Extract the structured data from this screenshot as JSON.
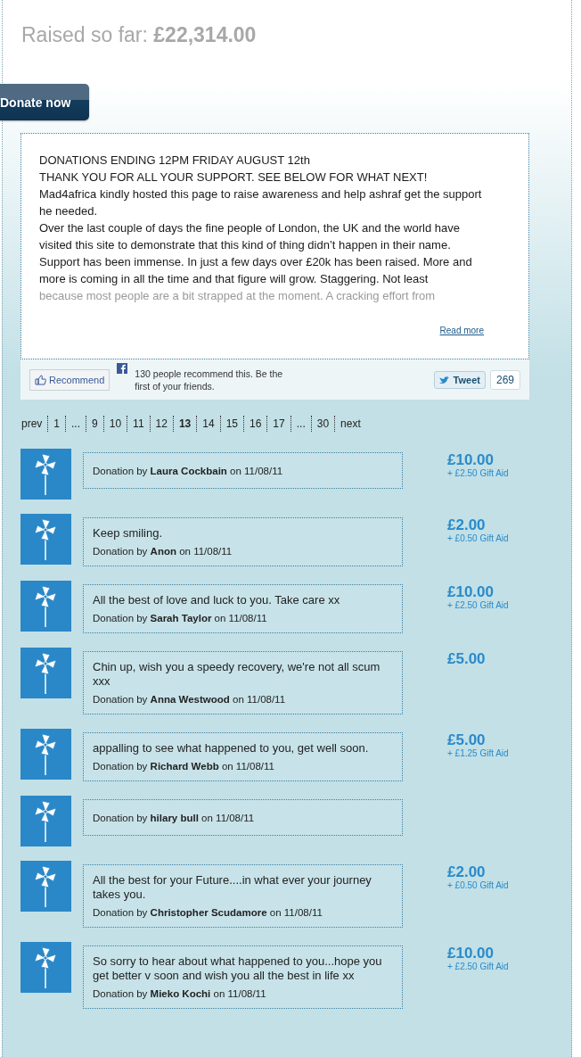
{
  "raised": {
    "label": "Raised so far:",
    "amount": "£22,314.00"
  },
  "donate_button": "Donate now",
  "story": {
    "lines": [
      "DONATIONS ENDING 12PM FRIDAY AUGUST 12th",
      "THANK YOU FOR ALL YOUR SUPPORT. SEE BELOW FOR WHAT NEXT!",
      "Mad4africa kindly hosted this page to raise awareness and  help ashraf get the support he needed.",
      "Over the last couple of days the fine people of London, the UK and the world have visited this site to demonstrate that this kind of thing didn’t happen in their name. Support has been immense. In just a few days over £20k has been raised. More and more is coming in all the time and that figure will grow. Staggering. Not least"
    ],
    "faded_line": "because most people are a bit strapped at the moment. A cracking effort from",
    "read_more": "Read more"
  },
  "social": {
    "recommend": "Recommend",
    "recommend_text": "130 people recommend this. Be the first of your friends.",
    "tweet": "Tweet",
    "tweet_count": "269"
  },
  "pagination": [
    {
      "label": "prev",
      "selected": false
    },
    {
      "label": "1",
      "selected": false
    },
    {
      "label": "...",
      "selected": false
    },
    {
      "label": "9",
      "selected": false
    },
    {
      "label": "10",
      "selected": false
    },
    {
      "label": "11",
      "selected": false
    },
    {
      "label": "12",
      "selected": false
    },
    {
      "label": "13",
      "selected": true
    },
    {
      "label": "14",
      "selected": false
    },
    {
      "label": "15",
      "selected": false
    },
    {
      "label": "16",
      "selected": false
    },
    {
      "label": "17",
      "selected": false
    },
    {
      "label": "...",
      "selected": false
    },
    {
      "label": "30",
      "selected": false
    },
    {
      "label": "next",
      "selected": false
    }
  ],
  "donations": [
    {
      "byline": "Donation by **Laura Cockbain** on 11/08/11",
      "amount": "£10.00",
      "gift_aid": "+ £2.50 Gift Aid"
    },
    {
      "message": "Keep smiling.",
      "byline": "Donation by **Anon** on 11/08/11",
      "amount": "£2.00",
      "gift_aid": "+ £0.50 Gift Aid"
    },
    {
      "message": "All the best of love and luck to you. Take care xx",
      "byline": "Donation by **Sarah Taylor** on 11/08/11",
      "amount": "£10.00",
      "gift_aid": "+ £2.50 Gift Aid"
    },
    {
      "message": "Chin up, wish you a speedy recovery, we're not all scum xxx",
      "byline": "Donation by **Anna Westwood** on 11/08/11",
      "amount": "£5.00"
    },
    {
      "message": "appalling to see what happened to you, get well soon.",
      "byline": "Donation by **Richard Webb** on 11/08/11",
      "amount": "£5.00",
      "gift_aid": "+ £1.25 Gift Aid"
    },
    {
      "byline": "Donation by **hilary bull** on 11/08/11"
    },
    {
      "message": "All the best for your Future....in what ever your journey takes you.",
      "byline": "Donation by **Christopher Scudamore** on 11/08/11",
      "amount": "£2.00",
      "gift_aid": "+ £0.50 Gift Aid"
    },
    {
      "message": "So sorry to hear about what happened to you...hope you get better v soon and wish you all the best in life xx",
      "byline": "Donation by **Mieko Kochi** on 11/08/11",
      "amount": "£10.00",
      "gift_aid": "+ £2.50 Gift Aid"
    }
  ]
}
